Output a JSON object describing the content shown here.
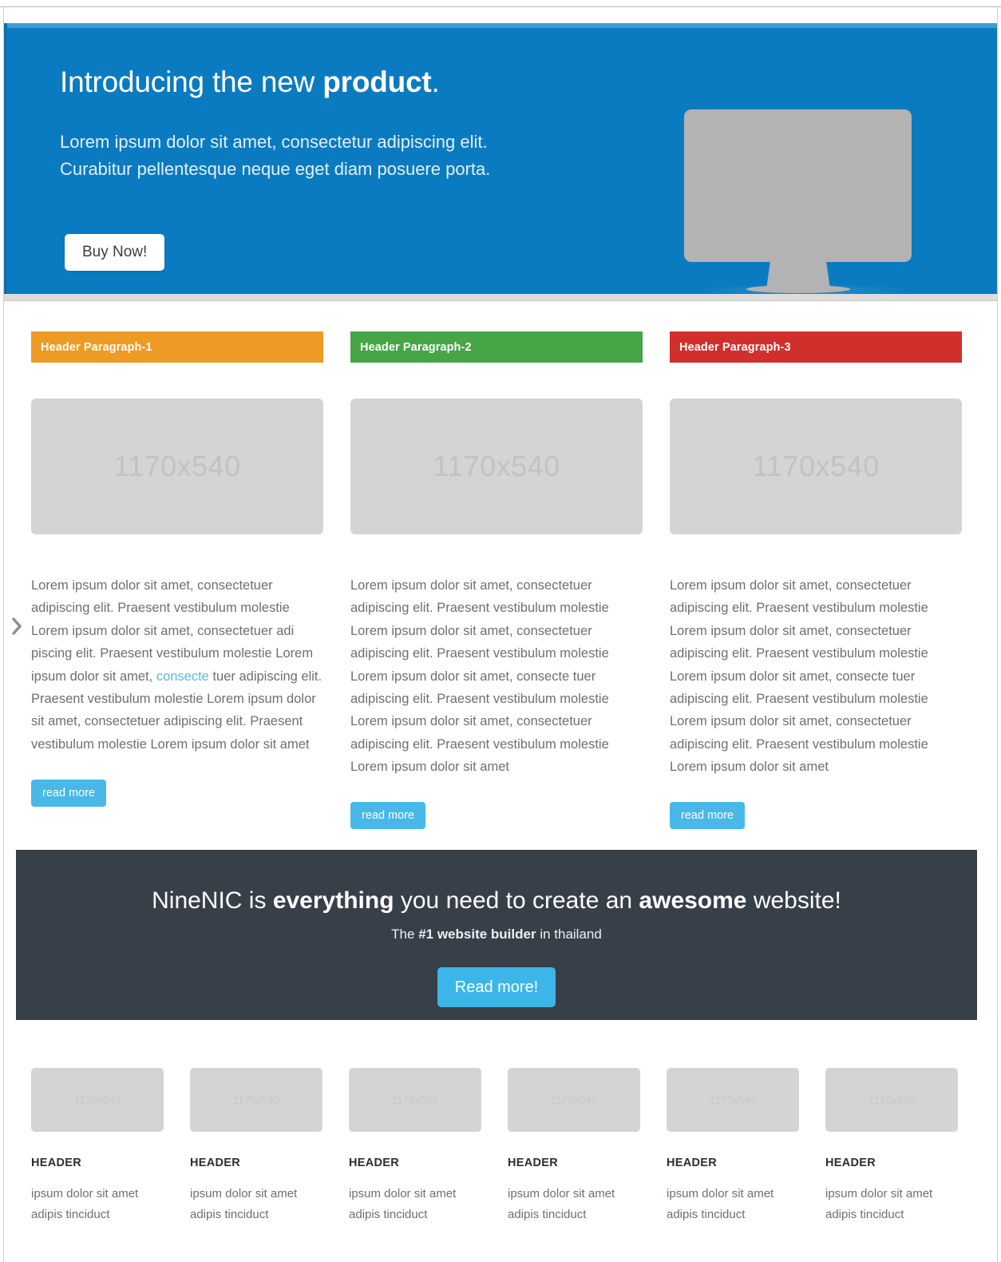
{
  "colors": {
    "hero_bg": "#0b7bc1",
    "hero_top_strip": "#3a9ed6",
    "header_1": "#ed9b24",
    "header_2": "#46a546",
    "header_3": "#d12f2c",
    "read_more_btn": "#47b8e8",
    "cta_bg": "#373f49",
    "cta_btn": "#3cb6e8",
    "link": "#5fb7e0",
    "placeholder": "#d4d4d4"
  },
  "hero": {
    "title_prefix": "Introducing the new ",
    "title_bold": "product",
    "title_suffix": ".",
    "subtitle_line1": "Lorem ipsum dolor sit amet, consectetur adipiscing elit.",
    "subtitle_line2": "Curabitur pellentesque neque eget diam posuere porta.",
    "buy_button": "Buy Now!",
    "illustration": "desktop-monitor"
  },
  "edge_toggle": {
    "icon": "chevron-right-icon"
  },
  "features": [
    {
      "header": "Header Paragraph-1",
      "header_color": "#ed9b24",
      "image_label": "1170x540",
      "body_before_link": "Lorem ipsum dolor sit amet, consectetuer adipiscing elit. Praesent vestibulum molestie Lorem ipsum dolor sit amet, consectetuer adi piscing elit. Praesent vestibulum molestie Lorem ipsum dolor sit amet, ",
      "body_link": "consecte",
      "body_after_link": " tuer adipiscing elit. Praesent vestibulum molestie Lorem ipsum dolor sit amet, consectetuer adipiscing elit. Praesent vestibulum molestie Lorem ipsum dolor sit amet",
      "button": "read more"
    },
    {
      "header": "Header Paragraph-2",
      "header_color": "#46a546",
      "image_label": "1170x540",
      "body": "Lorem ipsum dolor sit amet, consectetuer adipiscing elit. Praesent vestibulum molestie Lorem ipsum dolor sit amet, consectetuer adipiscing elit. Praesent vestibulum molestie Lorem ipsum dolor sit amet, consecte tuer adipiscing elit. Praesent vestibulum molestie Lorem ipsum dolor sit amet, consectetuer adipiscing elit. Praesent vestibulum molestie Lorem ipsum dolor sit amet",
      "button": "read more"
    },
    {
      "header": "Header Paragraph-3",
      "header_color": "#d12f2c",
      "image_label": "1170x540",
      "body": "Lorem ipsum dolor sit amet, consectetuer adipiscing elit. Praesent vestibulum molestie Lorem ipsum dolor sit amet, consectetuer adipiscing elit. Praesent vestibulum molestie Lorem ipsum dolor sit amet, consecte tuer adipiscing elit. Praesent vestibulum molestie Lorem ipsum dolor sit amet, consectetuer adipiscing elit. Praesent vestibulum molestie Lorem ipsum dolor sit amet",
      "button": "read more"
    }
  ],
  "cta": {
    "title_part1": "NineNIC is ",
    "title_bold1": "everything",
    "title_part2": " you need to create an ",
    "title_bold2": "awesome",
    "title_part3": " website!",
    "sub_part1": "The ",
    "sub_bold": "#1 website builder",
    "sub_part2": " in thailand",
    "button": "Read more!"
  },
  "tiles": [
    {
      "image_label": "1170x540",
      "header": "HEADER",
      "body_line1": "ipsum dolor sit amet",
      "body_line2": "adipis tinciduct"
    },
    {
      "image_label": "1170x540",
      "header": "HEADER",
      "body_line1": "ipsum dolor sit amet",
      "body_line2": "adipis tinciduct"
    },
    {
      "image_label": "1170x540",
      "header": "HEADER",
      "body_line1": "ipsum dolor sit amet",
      "body_line2": "adipis tinciduct"
    },
    {
      "image_label": "1170x540",
      "header": "HEADER",
      "body_line1": "ipsum dolor sit amet",
      "body_line2": "adipis tinciduct"
    },
    {
      "image_label": "1170x540",
      "header": "HEADER",
      "body_line1": "ipsum dolor sit amet",
      "body_line2": "adipis tinciduct"
    },
    {
      "image_label": "1170x540",
      "header": "HEADER",
      "body_line1": "ipsum dolor sit amet",
      "body_line2": "adipis tinciduct"
    }
  ]
}
